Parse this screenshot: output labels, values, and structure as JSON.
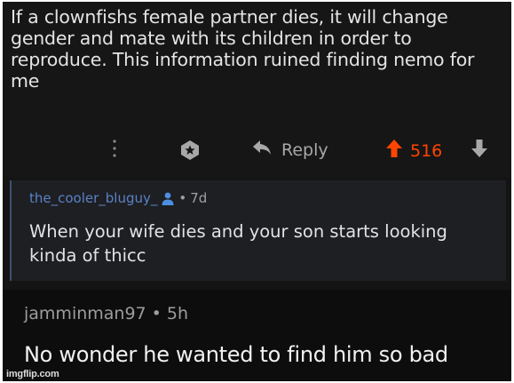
{
  "post": {
    "text": "If a clownfishs female partner dies, it will change gender and mate with its children in order to reproduce. This information ruined finding nemo for me",
    "actions": {
      "more_icon": "vertical-dots-icon",
      "award_icon": "award-icon",
      "reply_icon": "reply-arrow-icon",
      "reply_label": "Reply",
      "upvote_icon": "upvote-arrow-icon",
      "score": "516",
      "downvote_icon": "downvote-arrow-icon"
    },
    "colors": {
      "upvote": "#ff4500",
      "muted": "#a8a8a8"
    }
  },
  "reply1": {
    "username": "the_cooler_bluguy_",
    "user_icon": "user-icon",
    "separator": "•",
    "age": "7d",
    "text": "When your wife dies and your son starts looking kinda of thicc",
    "colors": {
      "username": "#5a82c4"
    }
  },
  "reply2": {
    "username": "jamminman97",
    "separator": "•",
    "age": "5h",
    "text": "No wonder he wanted to find him so bad"
  },
  "watermark": "imgflip.com"
}
